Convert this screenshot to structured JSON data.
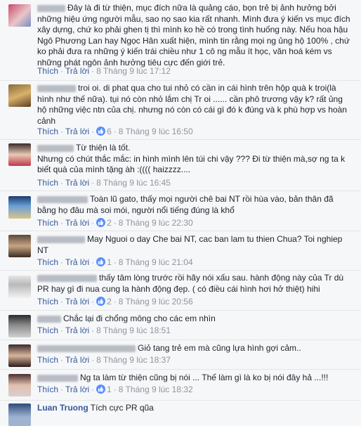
{
  "actions": {
    "like": "Thích",
    "reply": "Trả lời",
    "dot": "·"
  },
  "comments": [
    {
      "text": "Đây là đi từ thiện, mục đích nữa là quảng cáo, bọn trẻ bị ảnh hưởng bởi những hiệu ứng người mẫu, sao nọ sao kia rất nhanh. Mình đưa ý kiến vs mục đích xây dựng, chứ ko phải ghen tị thì mình ko hề có trong tình huống này. Nếu hoa hậu Ngô Phương Lan hay Ngọc Hân xuất hiện, mình tin rằng mọi ng ủng hộ 100% , chứ ko phải đưa ra những ý kiến trái chiều như 1 cô ng mẫu ít học, văn hoá kém vs những phát ngôn ảnh hưởng tiêu cực đến giới trẻ.",
      "time": "8 Tháng 9 lúc 17:12",
      "likes": ""
    },
    {
      "text": "troi oi. di phat qua cho tui nhỏ có cần in cái hình trên hộp quà k troi(là hình như thế nữa). tụi nó còn nhỏ lắm chị Tr oi ...... cần phô trương vậy k? rất ủng hộ những việc ntn của chị. nhưng nó còn có cái gì đó k đúng và k phù hợp vs hoàn cảnh",
      "time": "8 Tháng 9 lúc 16:50",
      "likes": "6"
    },
    {
      "text": "Từ thiện là tốt.",
      "text2": "Nhưng có chút thắc mắc: in hình mình lên túi chi vậy ??? Đi từ thiện mà,sợ ng ta k biết quà của mình tặng àh :(((( haizzzz....",
      "time": "8 Tháng 9 lúc 16:45",
      "likes": ""
    },
    {
      "text": "Toàn lũ gato, thấy mọi người chê bai NT rồi hùa vào, bản thân đã bằng họ đâu mà soi mói, người nổi tiếng đúng là khổ",
      "time": "8 Tháng 9 lúc 22:30",
      "likes": "2"
    },
    {
      "text": "May Nguoi o day Che bai NT, cac ban lam tu thien Chua? Toi nghiep NT",
      "time": "8 Tháng 9 lúc 21:04",
      "likes": "1"
    },
    {
      "text": "thấy tâm lòng trước rồi hãy nói xấu sau. hành động này của Tr dù PR hay gì đi nua cung la hành động đẹp. ( có điều cái hình hơi hở thiệt) hihi",
      "time": "8 Tháng 9 lúc 20:56",
      "likes": "2"
    },
    {
      "text": "Chắc lại đi chổng mông cho các em nhìn",
      "time": "8 Tháng 9 lúc 18:51",
      "likes": ""
    },
    {
      "text": "Giỏ tang trẻ em mà cũng lựa hình gợi cảm..",
      "time": "8 Tháng 9 lúc 18:37",
      "likes": ""
    },
    {
      "text": "Ng ta làm từ thiện cũng bị nói ... Thế làm gì là ko bị nói đây hả ...!!!",
      "time": "8 Tháng 9 lúc 18:32",
      "likes": "1"
    },
    {
      "name": "Luan Truong",
      "text": "Tích cực PR qũa"
    }
  ],
  "colors": {
    "link": "#365899",
    "meta": "#90949c",
    "like": "#5890ff"
  }
}
